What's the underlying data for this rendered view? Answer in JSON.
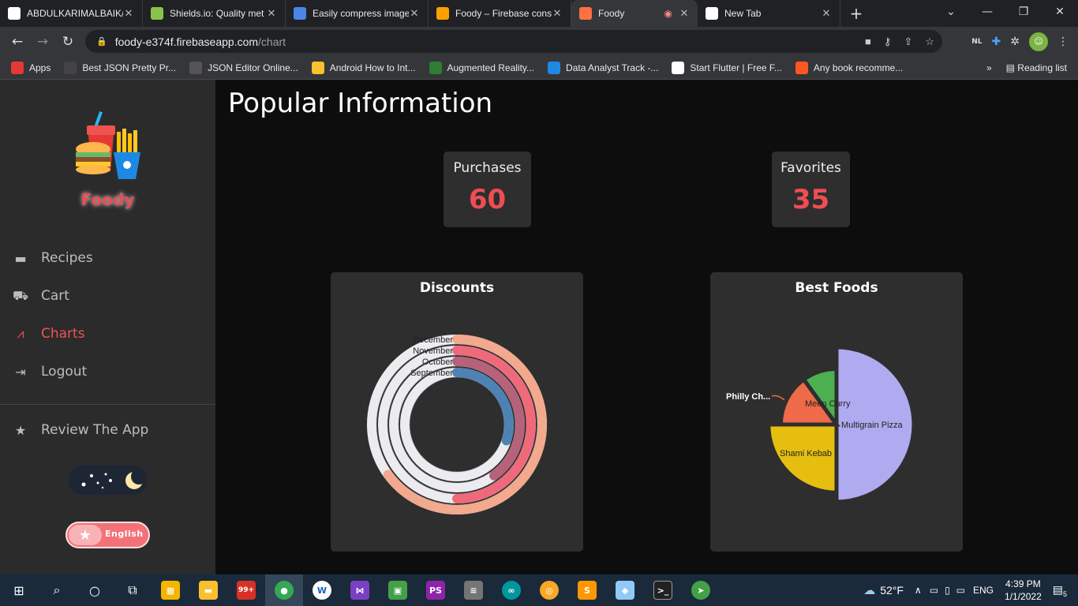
{
  "browser": {
    "tabs": [
      {
        "title": "ABDULKARIMALBAIK/",
        "color": "#ffffff",
        "active": false
      },
      {
        "title": "Shields.io: Quality met",
        "color": "#8bc34a",
        "active": false
      },
      {
        "title": "Easily compress image",
        "color": "#4a86e8",
        "active": false
      },
      {
        "title": "Foody – Firebase cons",
        "color": "#ffa000",
        "active": false
      },
      {
        "title": "Foody",
        "color": "#ff7043",
        "active": true
      },
      {
        "title": "New Tab",
        "color": "#ffffff",
        "active": false
      }
    ],
    "url_host": "foody-e374f.firebaseapp.com",
    "url_path": "/chart",
    "bookmarks": [
      {
        "label": "Apps",
        "color": "#e53935"
      },
      {
        "label": "Best JSON Pretty Pr...",
        "color": "#444444"
      },
      {
        "label": "JSON Editor Online...",
        "color": "#555555"
      },
      {
        "label": "Android How to Int...",
        "color": "#fbc02d"
      },
      {
        "label": "Augmented Reality...",
        "color": "#2e7d32"
      },
      {
        "label": "Data Analyst Track -...",
        "color": "#1e88e5"
      },
      {
        "label": "Start Flutter | Free F...",
        "color": "#ffffff"
      },
      {
        "label": "Any book recomme...",
        "color": "#ff5722"
      }
    ],
    "reading_list": "Reading list",
    "overflow": "»",
    "profile_badge": "NL"
  },
  "sidebar": {
    "brand": "Foody",
    "items": [
      {
        "label": "Recipes",
        "icon": "recipes-icon"
      },
      {
        "label": "Cart",
        "icon": "cart-icon"
      },
      {
        "label": "Charts",
        "icon": "chart-icon"
      },
      {
        "label": "Logout",
        "icon": "logout-icon"
      }
    ],
    "review": "Review The App",
    "language": "English"
  },
  "main": {
    "title": "Popular Information",
    "stats": [
      {
        "label": "Purchases",
        "value": "60"
      },
      {
        "label": "Favorites",
        "value": "35"
      }
    ]
  },
  "chart_data": [
    {
      "type": "radial-bar",
      "title": "Discounts",
      "categories": [
        "September",
        "October",
        "November",
        "December"
      ],
      "values": [
        30,
        40,
        50,
        65
      ],
      "max": 100,
      "colors": [
        "#4e82b4",
        "#b5627a",
        "#ee6a7b",
        "#f2a98e"
      ]
    },
    {
      "type": "pie",
      "title": "Best Foods",
      "labels": [
        "Multigrain Pizza",
        "Shami Kebab",
        "Philly Ch...",
        "Meen Curry"
      ],
      "values": [
        50,
        25,
        15,
        10
      ],
      "colors": [
        "#b0aaf0",
        "#e6be0f",
        "#ef6a48",
        "#4caf50"
      ]
    }
  ],
  "taskbar": {
    "weather": "52°F",
    "language": "ENG",
    "time": "4:39 PM",
    "date": "1/1/2022",
    "notifications": "5",
    "gmail_badge": "99+"
  }
}
